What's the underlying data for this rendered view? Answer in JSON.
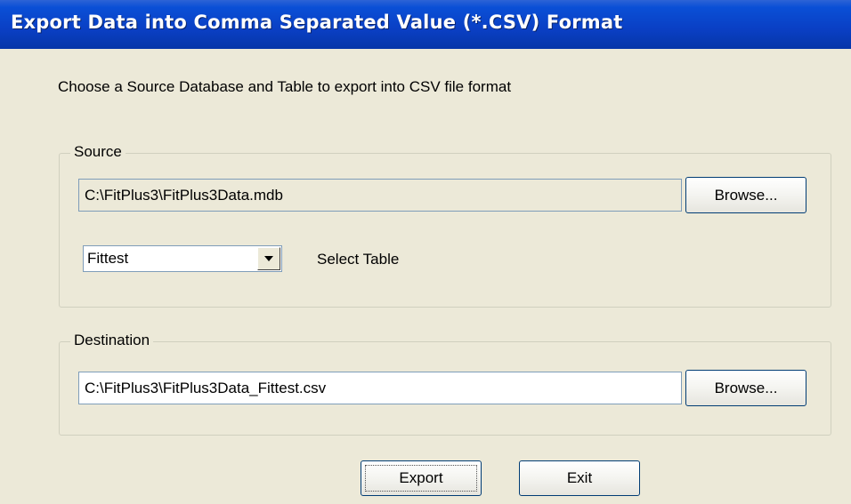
{
  "window": {
    "title": "Export Data into Comma Separated Value (*.CSV) Format"
  },
  "description": "Choose a Source Database and Table to export into CSV file format",
  "source": {
    "legend": "Source",
    "path_value": "C:\\FitPlus3\\FitPlus3Data.mdb",
    "browse_label": "Browse...",
    "table_value": "Fittest",
    "select_table_label": "Select Table"
  },
  "destination": {
    "legend": "Destination",
    "path_value": "C:\\FitPlus3\\FitPlus3Data_Fittest.csv",
    "browse_label": "Browse..."
  },
  "actions": {
    "export_label": "Export",
    "exit_label": "Exit"
  },
  "icons": {
    "dropdown": "chevron-down-icon"
  }
}
